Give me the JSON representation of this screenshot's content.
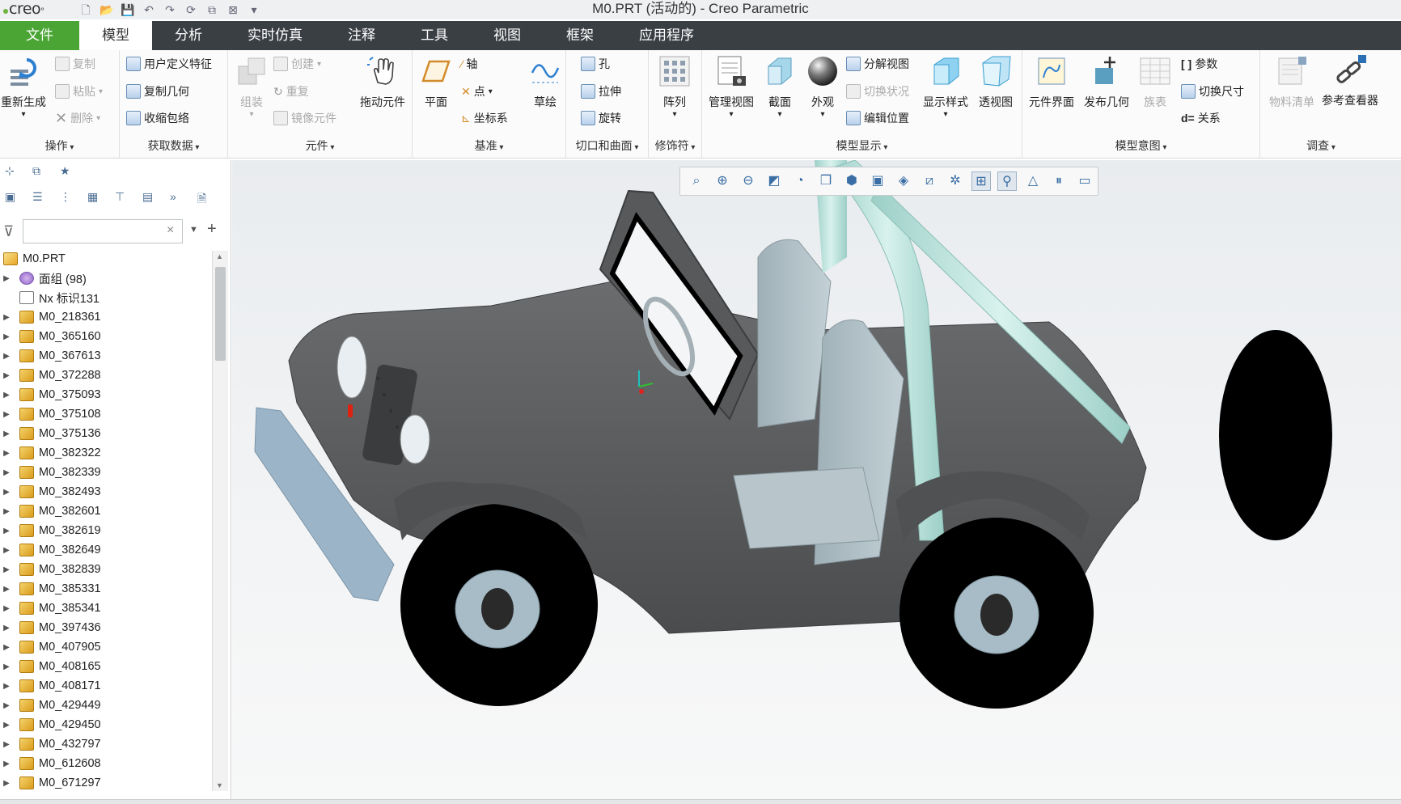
{
  "window": {
    "logo": "creo",
    "title": "M0.PRT (活动的) - Creo Parametric"
  },
  "tabs": [
    "文件",
    "模型",
    "分析",
    "实时仿真",
    "注释",
    "工具",
    "视图",
    "框架",
    "应用程序"
  ],
  "active_tab": "模型",
  "ribbon": {
    "groups": {
      "operations": "操作",
      "get_data": "获取数据",
      "component": "元件",
      "datum": "基准",
      "cut_surface": "切口和曲面",
      "modifier": "修饰符",
      "model_display": "模型显示",
      "model_intent": "模型意图",
      "investigate": "调查"
    },
    "buttons": {
      "regenerate": "重新生成",
      "copy": "复制",
      "paste": "粘贴",
      "delete": "删除",
      "udf": "用户定义特征",
      "copy_geom": "复制几何",
      "shrinkwrap": "收缩包络",
      "assemble": "组装",
      "create": "创建",
      "repeat": "重复",
      "mirror_comp": "镜像元件",
      "drag_comp": "拖动元件",
      "plane": "平面",
      "axis": "轴",
      "point": "点",
      "csys": "坐标系",
      "sketch": "草绘",
      "hole": "孔",
      "extrude": "拉伸",
      "revolve": "旋转",
      "pattern": "阵列",
      "manage_views": "管理视图",
      "section": "截面",
      "appearance": "外观",
      "explode": "分解视图",
      "toggle_status": "切换状况",
      "edit_position": "编辑位置",
      "display_style": "显示样式",
      "perspective": "透视图",
      "comp_interface": "元件界面",
      "publish_geom": "发布几何",
      "family_table": "族表",
      "parameters": "参数",
      "switch_dims": "切换尺寸",
      "relations": "关系",
      "bom": "物料清单",
      "ref_viewer": "参考查看器"
    }
  },
  "tree": {
    "root": "M0.PRT",
    "items": [
      "面组 (98)",
      "Nx 标识131",
      "M0_218361",
      "M0_365160",
      "M0_367613",
      "M0_372288",
      "M0_375093",
      "M0_375108",
      "M0_375136",
      "M0_382322",
      "M0_382339",
      "M0_382493",
      "M0_382601",
      "M0_382619",
      "M0_382649",
      "M0_382839",
      "M0_385331",
      "M0_385341",
      "M0_397436",
      "M0_407905",
      "M0_408165",
      "M0_408171",
      "M0_429449",
      "M0_429450",
      "M0_432797",
      "M0_612608",
      "M0_671297"
    ],
    "search_placeholder": ""
  },
  "colors": {
    "file_tab": "#4aa535",
    "tab_bar": "#3a3f44",
    "body": "#555759",
    "seats": "#a9b9bf",
    "rollbar": "#b6ddd6"
  }
}
